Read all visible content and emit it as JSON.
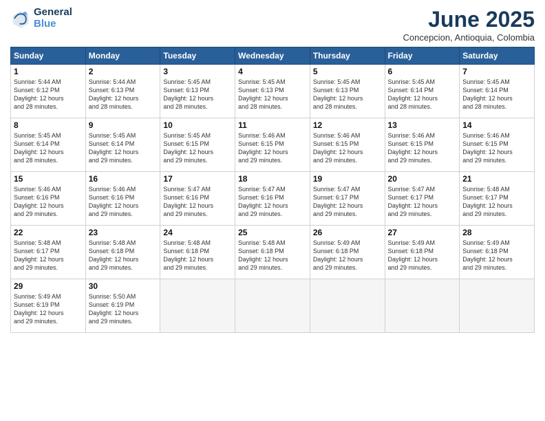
{
  "header": {
    "logo_line1": "General",
    "logo_line2": "Blue",
    "month": "June 2025",
    "location": "Concepcion, Antioquia, Colombia"
  },
  "weekdays": [
    "Sunday",
    "Monday",
    "Tuesday",
    "Wednesday",
    "Thursday",
    "Friday",
    "Saturday"
  ],
  "weeks": [
    [
      {
        "day": "1",
        "info": "Sunrise: 5:44 AM\nSunset: 6:12 PM\nDaylight: 12 hours\nand 28 minutes."
      },
      {
        "day": "2",
        "info": "Sunrise: 5:44 AM\nSunset: 6:13 PM\nDaylight: 12 hours\nand 28 minutes."
      },
      {
        "day": "3",
        "info": "Sunrise: 5:45 AM\nSunset: 6:13 PM\nDaylight: 12 hours\nand 28 minutes."
      },
      {
        "day": "4",
        "info": "Sunrise: 5:45 AM\nSunset: 6:13 PM\nDaylight: 12 hours\nand 28 minutes."
      },
      {
        "day": "5",
        "info": "Sunrise: 5:45 AM\nSunset: 6:13 PM\nDaylight: 12 hours\nand 28 minutes."
      },
      {
        "day": "6",
        "info": "Sunrise: 5:45 AM\nSunset: 6:14 PM\nDaylight: 12 hours\nand 28 minutes."
      },
      {
        "day": "7",
        "info": "Sunrise: 5:45 AM\nSunset: 6:14 PM\nDaylight: 12 hours\nand 28 minutes."
      }
    ],
    [
      {
        "day": "8",
        "info": "Sunrise: 5:45 AM\nSunset: 6:14 PM\nDaylight: 12 hours\nand 28 minutes."
      },
      {
        "day": "9",
        "info": "Sunrise: 5:45 AM\nSunset: 6:14 PM\nDaylight: 12 hours\nand 29 minutes."
      },
      {
        "day": "10",
        "info": "Sunrise: 5:45 AM\nSunset: 6:15 PM\nDaylight: 12 hours\nand 29 minutes."
      },
      {
        "day": "11",
        "info": "Sunrise: 5:46 AM\nSunset: 6:15 PM\nDaylight: 12 hours\nand 29 minutes."
      },
      {
        "day": "12",
        "info": "Sunrise: 5:46 AM\nSunset: 6:15 PM\nDaylight: 12 hours\nand 29 minutes."
      },
      {
        "day": "13",
        "info": "Sunrise: 5:46 AM\nSunset: 6:15 PM\nDaylight: 12 hours\nand 29 minutes."
      },
      {
        "day": "14",
        "info": "Sunrise: 5:46 AM\nSunset: 6:15 PM\nDaylight: 12 hours\nand 29 minutes."
      }
    ],
    [
      {
        "day": "15",
        "info": "Sunrise: 5:46 AM\nSunset: 6:16 PM\nDaylight: 12 hours\nand 29 minutes."
      },
      {
        "day": "16",
        "info": "Sunrise: 5:46 AM\nSunset: 6:16 PM\nDaylight: 12 hours\nand 29 minutes."
      },
      {
        "day": "17",
        "info": "Sunrise: 5:47 AM\nSunset: 6:16 PM\nDaylight: 12 hours\nand 29 minutes."
      },
      {
        "day": "18",
        "info": "Sunrise: 5:47 AM\nSunset: 6:16 PM\nDaylight: 12 hours\nand 29 minutes."
      },
      {
        "day": "19",
        "info": "Sunrise: 5:47 AM\nSunset: 6:17 PM\nDaylight: 12 hours\nand 29 minutes."
      },
      {
        "day": "20",
        "info": "Sunrise: 5:47 AM\nSunset: 6:17 PM\nDaylight: 12 hours\nand 29 minutes."
      },
      {
        "day": "21",
        "info": "Sunrise: 5:48 AM\nSunset: 6:17 PM\nDaylight: 12 hours\nand 29 minutes."
      }
    ],
    [
      {
        "day": "22",
        "info": "Sunrise: 5:48 AM\nSunset: 6:17 PM\nDaylight: 12 hours\nand 29 minutes."
      },
      {
        "day": "23",
        "info": "Sunrise: 5:48 AM\nSunset: 6:18 PM\nDaylight: 12 hours\nand 29 minutes."
      },
      {
        "day": "24",
        "info": "Sunrise: 5:48 AM\nSunset: 6:18 PM\nDaylight: 12 hours\nand 29 minutes."
      },
      {
        "day": "25",
        "info": "Sunrise: 5:48 AM\nSunset: 6:18 PM\nDaylight: 12 hours\nand 29 minutes."
      },
      {
        "day": "26",
        "info": "Sunrise: 5:49 AM\nSunset: 6:18 PM\nDaylight: 12 hours\nand 29 minutes."
      },
      {
        "day": "27",
        "info": "Sunrise: 5:49 AM\nSunset: 6:18 PM\nDaylight: 12 hours\nand 29 minutes."
      },
      {
        "day": "28",
        "info": "Sunrise: 5:49 AM\nSunset: 6:18 PM\nDaylight: 12 hours\nand 29 minutes."
      }
    ],
    [
      {
        "day": "29",
        "info": "Sunrise: 5:49 AM\nSunset: 6:19 PM\nDaylight: 12 hours\nand 29 minutes."
      },
      {
        "day": "30",
        "info": "Sunrise: 5:50 AM\nSunset: 6:19 PM\nDaylight: 12 hours\nand 29 minutes."
      },
      {
        "day": "",
        "info": ""
      },
      {
        "day": "",
        "info": ""
      },
      {
        "day": "",
        "info": ""
      },
      {
        "day": "",
        "info": ""
      },
      {
        "day": "",
        "info": ""
      }
    ]
  ]
}
